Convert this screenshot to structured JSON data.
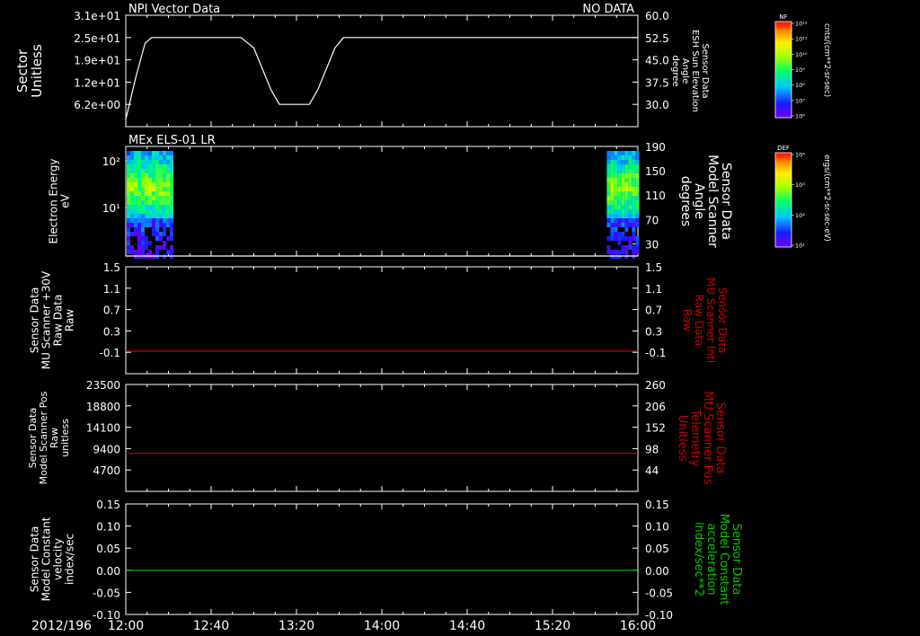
{
  "colors": {
    "background": "#000000",
    "axis": "#ffffff",
    "red": "#cc0000",
    "green": "#00cc00"
  },
  "date_label": "2012/196",
  "chart_data": [
    {
      "type": "line",
      "panel_title": "NPI Vector Data",
      "status": "NO DATA",
      "ylabel_left": [
        "Sector",
        "Unitless"
      ],
      "ylabel_right": [
        "Sensor Data",
        "ESH Sun Elevation",
        "Angle",
        "degree"
      ],
      "left_ticks": [
        "3.1e+01",
        "2.5e+01",
        "1.9e+01",
        "1.2e+01",
        "6.2e+00"
      ],
      "right_ticks": [
        "60.0",
        "52.5",
        "45.0",
        "37.5",
        "30.0"
      ],
      "ylim_right": [
        22.5,
        60
      ],
      "series": [
        {
          "color": "#ffffff",
          "x": [
            "12:00",
            "12:05",
            "12:09",
            "12:12",
            "12:54",
            "13:00",
            "13:08",
            "13:12",
            "13:26",
            "13:30",
            "13:38",
            "13:42",
            "16:00"
          ],
          "values": [
            25.0,
            40.0,
            50.5,
            52.5,
            52.5,
            49.0,
            35.0,
            30.0,
            30.0,
            35.0,
            49.0,
            52.5,
            52.5
          ]
        }
      ]
    },
    {
      "type": "heatmap",
      "panel_title": "MEx ELS-01 LR",
      "ylabel_left": [
        "Electron Energy",
        "eV"
      ],
      "ylabel_right": [
        "Sensor Data",
        "Model Scanner",
        "Angle",
        "degrees"
      ],
      "left_ticks": [
        "10²",
        "10¹"
      ],
      "right_ticks": [
        "190",
        "150",
        "110",
        "70",
        "30"
      ],
      "ylim_right": [
        10,
        190
      ],
      "data_blocks": [
        {
          "x": [
            "12:00",
            "12:21"
          ]
        },
        {
          "x": [
            "15:45",
            "16:00"
          ]
        }
      ],
      "line_value": 10
    },
    {
      "type": "line",
      "ylabel_left": [
        "Sensor Data",
        "MU Scanner +30V",
        "Raw Data",
        "Raw"
      ],
      "ylabel_right": [
        "Sensor Data",
        "MU Scanner Intl",
        "Raw Data",
        "Raw"
      ],
      "left_ticks": [
        "1.5",
        "1.1",
        "0.7",
        "0.3",
        "-0.1"
      ],
      "right_ticks": [
        "1.5",
        "1.1",
        "0.7",
        "0.3",
        "-0.1"
      ],
      "ylim": [
        -0.4,
        1.5
      ],
      "series": [
        {
          "color": "#cc0000",
          "x": [
            "12:00",
            "16:00"
          ],
          "values": [
            0.0,
            0.0
          ]
        }
      ]
    },
    {
      "type": "line",
      "ylabel_left": [
        "Sensor Data",
        "Model Scanner Pos",
        "Raw",
        "unitless"
      ],
      "ylabel_right": [
        "Sensor Data",
        "MU Scanner Pos",
        "Telemetry",
        "Unitless"
      ],
      "left_ticks": [
        "23500",
        "18800",
        "14100",
        "9400",
        "4700"
      ],
      "right_ticks": [
        "260",
        "206",
        "152",
        "98",
        "44"
      ],
      "ylim": [
        0,
        23500
      ],
      "series": [
        {
          "color": "#cc0000",
          "x": [
            "12:00",
            "16:00"
          ],
          "values": [
            8350,
            8350
          ]
        }
      ]
    },
    {
      "type": "line",
      "ylabel_left": [
        "Sensor Data",
        "Model Constant",
        "velocity",
        "index/sec"
      ],
      "ylabel_right": [
        "Sensor Data",
        "Model Constant",
        "acceleration",
        "index/sec**2"
      ],
      "left_ticks": [
        "0.15",
        "0.10",
        "0.05",
        "0.00",
        "-0.05",
        "-0.10"
      ],
      "right_ticks": [
        "0.15",
        "0.10",
        "0.05",
        "0.00",
        "-0.05",
        "-0.10"
      ],
      "ylim": [
        -0.1,
        0.15
      ],
      "series": [
        {
          "color": "#00cc00",
          "x": [
            "12:00",
            "16:00"
          ],
          "values": [
            0.0,
            0.0
          ]
        }
      ]
    }
  ],
  "x_axis": {
    "ticks": [
      "12:00",
      "12:40",
      "13:20",
      "14:00",
      "14:40",
      "15:20",
      "16:00"
    ],
    "range": [
      "12:00",
      "16:00"
    ]
  },
  "colorbars": [
    {
      "title": "NF",
      "units": "cnts/(cm**2-sr-sec)",
      "ticks": [
        "10¹²",
        "10¹¹",
        "10¹⁰",
        "10⁹",
        "10⁸",
        "10⁷",
        "10⁶"
      ]
    },
    {
      "title": "DEF",
      "units": "ergs/(cm**2-sr-sec-eV)",
      "ticks": [
        "10⁴",
        "10³",
        "10²",
        "10¹"
      ]
    }
  ]
}
